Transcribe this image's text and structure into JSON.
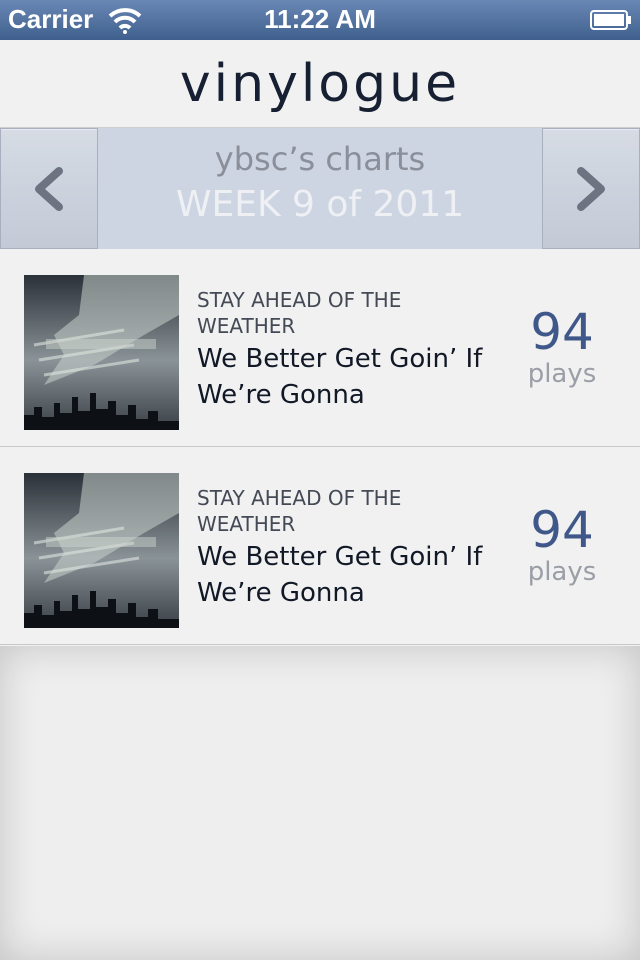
{
  "status_bar": {
    "carrier": "Carrier",
    "time": "11:22 AM",
    "wifi_icon": "wifi-icon",
    "battery_icon": "battery-icon"
  },
  "header": {
    "title": "vinylogue"
  },
  "week_nav": {
    "owner": "ybsc’s charts",
    "week": "WEEK 9 of 2011",
    "prev_icon": "chevron-left-icon",
    "next_icon": "chevron-right-icon"
  },
  "charts": [
    {
      "artist": "STAY AHEAD OF THE WEATHER",
      "album": "We Better Get Goin’ If We’re Gonna",
      "plays": "94",
      "plays_label": "plays"
    },
    {
      "artist": "STAY AHEAD OF THE WEATHER",
      "album": "We Better Get Goin’ If We’re Gonna",
      "plays": "94",
      "plays_label": "plays"
    }
  ],
  "colors": {
    "status_bar": "#4a6a98",
    "accent": "#3f5789",
    "week_nav_bg": "#cdd5e3"
  }
}
